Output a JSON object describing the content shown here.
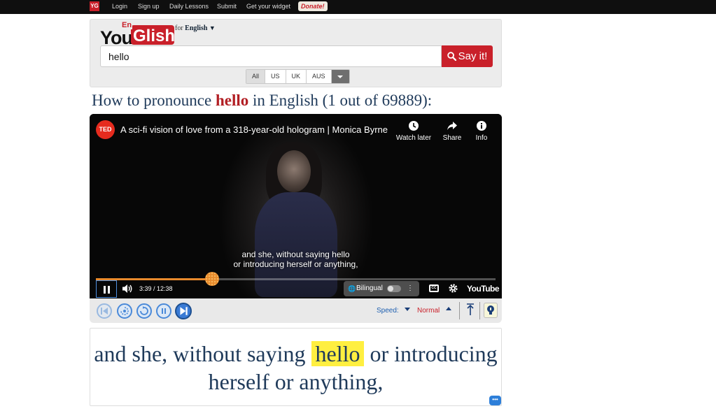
{
  "topnav": {
    "logo": "YG",
    "links": [
      "Login",
      "Sign up",
      "Daily Lessons",
      "Submit",
      "Get your widget"
    ],
    "donate": "Donate!"
  },
  "search": {
    "brand_you": "You",
    "brand_glish": "Glish",
    "brand_en": "En",
    "for_label": "for",
    "language": "English",
    "lang_arrow": "▼",
    "query": "hello",
    "button": "Say it!",
    "accents": [
      "All",
      "US",
      "UK",
      "AUS"
    ],
    "active_accent": "All"
  },
  "heading": {
    "prefix": "How to pronounce",
    "keyword": "hello",
    "suffix": "in English (1 out of 69889):"
  },
  "video": {
    "channel_logo": "TED",
    "title": "A sci-fi vision of love from a 318-year-old hologram | Monica Byrne",
    "actions": [
      "Watch later",
      "Share",
      "Info"
    ],
    "subtitle_line1": "and she, without saying hello",
    "subtitle_line2": "or introducing herself or anything,",
    "time": "3:39 / 12:38",
    "progress": 0.29,
    "bilingual_label": "Bilingual",
    "cc_label": "CC",
    "platform": "YouTube"
  },
  "controls": {
    "speed_label": "Speed:",
    "speed_value": "Normal"
  },
  "caption": {
    "before": "and she, without saying",
    "highlight": "hello",
    "after": "or introducing herself or anything,",
    "highlight_color": "#ffef40"
  },
  "colors": {
    "brand_red": "#c9202a",
    "heading_blue": "#1f3a5a",
    "accent_blue": "#4a89d8"
  },
  "icons": {
    "search": "search-icon",
    "clock": "clock-icon",
    "share": "share-icon",
    "info": "info-icon",
    "volume": "volume-icon",
    "settings": "gear-icon",
    "lightbulb": "lightbulb-icon",
    "chat": "chat-icon"
  }
}
